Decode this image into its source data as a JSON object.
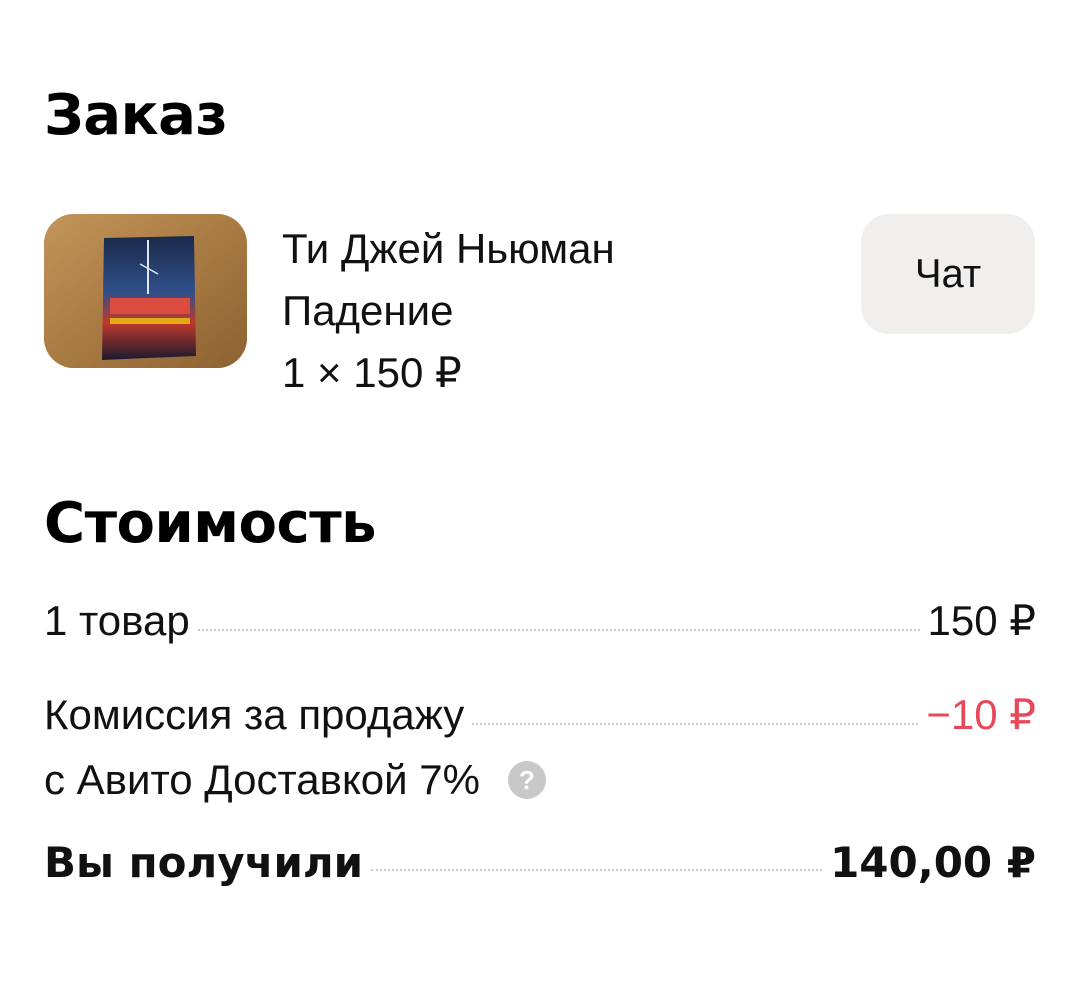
{
  "order": {
    "title": "Заказ",
    "item": {
      "author": "Ти Джей Ньюман",
      "name": "Падение",
      "quantity_price": "1 × 150 ₽",
      "image_icon": "book-cover-image"
    },
    "chat_label": "Чат"
  },
  "cost": {
    "title": "Стоимость",
    "items_label": "1 товар",
    "items_value": "150 ₽",
    "commission_label": "Комиссия за продажу",
    "commission_label_2": "с Авито Доставкой 7%",
    "commission_value": "−10 ₽",
    "help_icon": "?",
    "total_label": "Вы получили",
    "total_value": "140,00 ₽"
  },
  "colors": {
    "commission_value": "#e8485a",
    "chat_button_bg": "#f0efee",
    "help_icon_bg": "#c8c8c8"
  }
}
